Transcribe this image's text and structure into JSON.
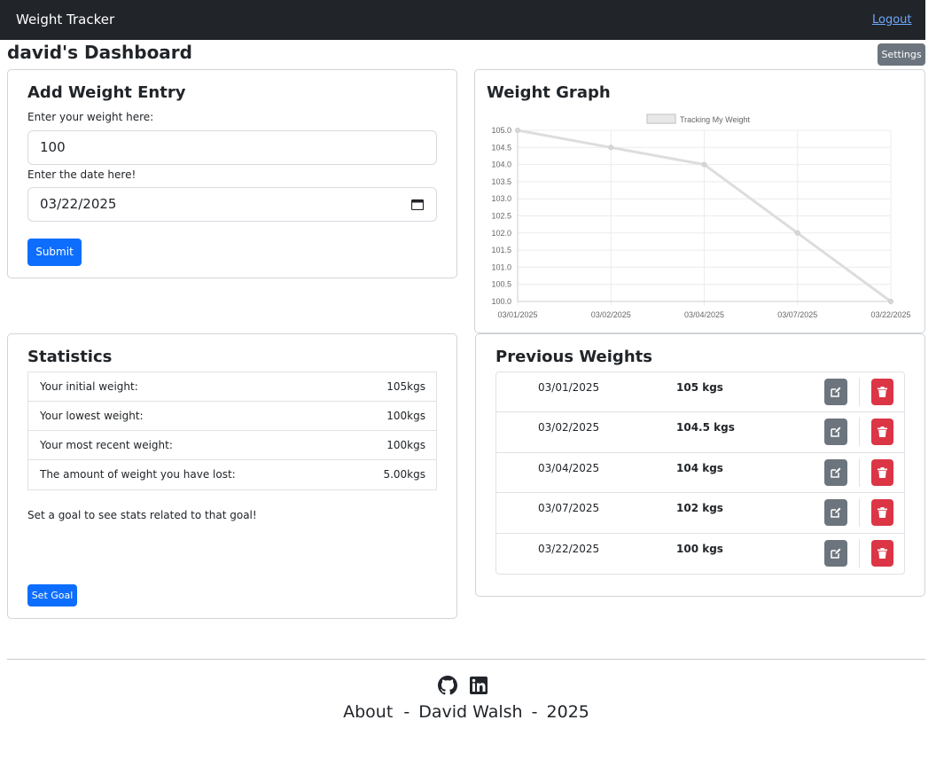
{
  "navbar": {
    "brand": "Weight Tracker",
    "logout": "Logout"
  },
  "dashboard": {
    "title": "david's Dashboard",
    "settings": "Settings"
  },
  "entry": {
    "title": "Add Weight Entry",
    "weight_label": "Enter your weight here:",
    "weight_value": "100",
    "date_label": "Enter the date here!",
    "date_value": "03/22/2025",
    "submit": "Submit"
  },
  "graph": {
    "title": "Weight Graph"
  },
  "chart_data": {
    "type": "line",
    "categories": [
      "03/01/2025",
      "03/02/2025",
      "03/04/2025",
      "03/07/2025",
      "03/22/2025"
    ],
    "series": [
      {
        "name": "Tracking My Weight",
        "values": [
          105,
          104.5,
          104,
          102,
          100
        ]
      }
    ],
    "ylim": [
      100,
      105
    ],
    "yticks": [
      "105.0",
      "104.5",
      "104.0",
      "103.5",
      "103.0",
      "102.5",
      "102.0",
      "101.5",
      "101.0",
      "100.5",
      "100.0"
    ],
    "grid": true,
    "legend": "top-center",
    "color": "#dddddd"
  },
  "stats": {
    "title": "Statistics",
    "rows": [
      {
        "label": "Your initial weight:",
        "value": "105kgs"
      },
      {
        "label": "Your lowest weight:",
        "value": "100kgs"
      },
      {
        "label": "Your most recent weight:",
        "value": "100kgs"
      },
      {
        "label": "The amount of weight you have lost:",
        "value": "5.00kgs"
      }
    ],
    "goal_message": "Set a goal to see stats related to that goal!",
    "set_goal": "Set Goal"
  },
  "previous": {
    "title": "Previous Weights",
    "rows": [
      {
        "date": "03/01/2025",
        "weight": "105 kgs"
      },
      {
        "date": "03/02/2025",
        "weight": "104.5 kgs"
      },
      {
        "date": "03/04/2025",
        "weight": "104 kgs"
      },
      {
        "date": "03/07/2025",
        "weight": "102 kgs"
      },
      {
        "date": "03/22/2025",
        "weight": "100 kgs"
      }
    ]
  },
  "footer": {
    "about": "About",
    "dash": "-",
    "name": "David Walsh",
    "year": "2025",
    "sep": "-"
  },
  "colors": {
    "primary": "#0d6efd",
    "secondary": "#6c757d",
    "danger": "#dc3545",
    "navbar": "#212529"
  }
}
